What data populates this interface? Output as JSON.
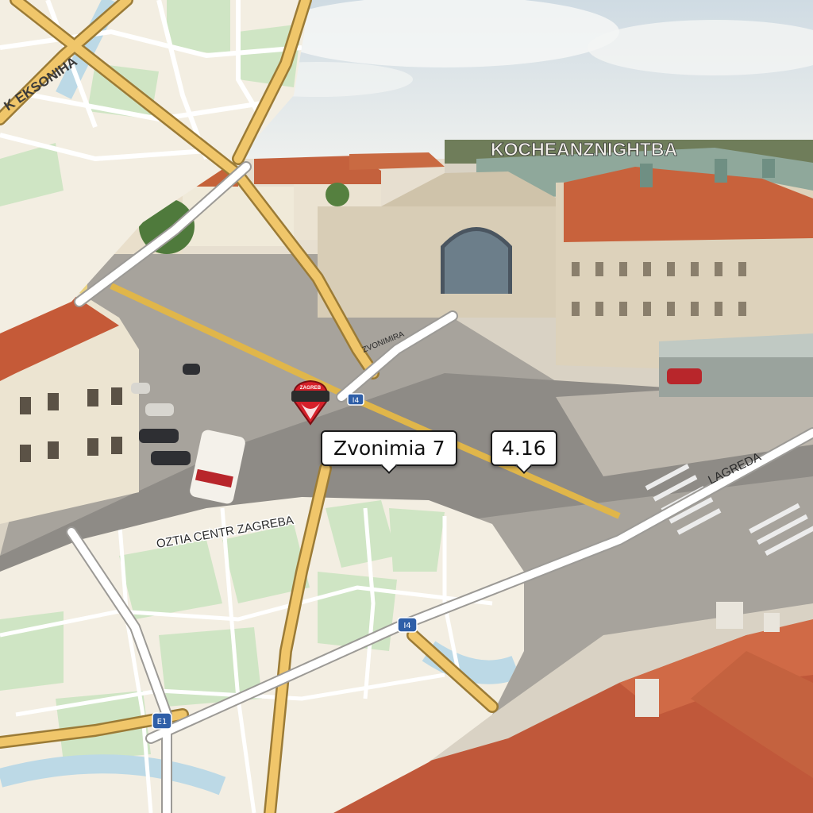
{
  "station": {
    "roof_sign": "KOCHEANZNIGHTBA"
  },
  "callouts": {
    "address": "Zvonimia 7",
    "distance": "4.16"
  },
  "map_labels": {
    "street_top_left": "K EKSONIHA",
    "street_center_south": "OZTIA CENTR ZAGREBA",
    "street_east": "LAGREDA",
    "street_plaza": "ZVONIMIRA"
  },
  "road_shields": [
    "I4",
    "I4",
    "E1"
  ],
  "pin": {
    "label": "ZAGREB",
    "icon": "location-pin-icon"
  },
  "colors": {
    "sky": "#dfe6ea",
    "roof_tile": "#c8623c",
    "station_stone": "#d8cdb6",
    "station_roof": "#8fa89b",
    "map_green": "#cfe5c4",
    "map_land": "#f3eee2",
    "water": "#bcd9e6",
    "major_road": "#f0c66a",
    "minor_road": "#ffffff",
    "pin_red": "#d6202a",
    "asphalt": "#8e8b86"
  }
}
